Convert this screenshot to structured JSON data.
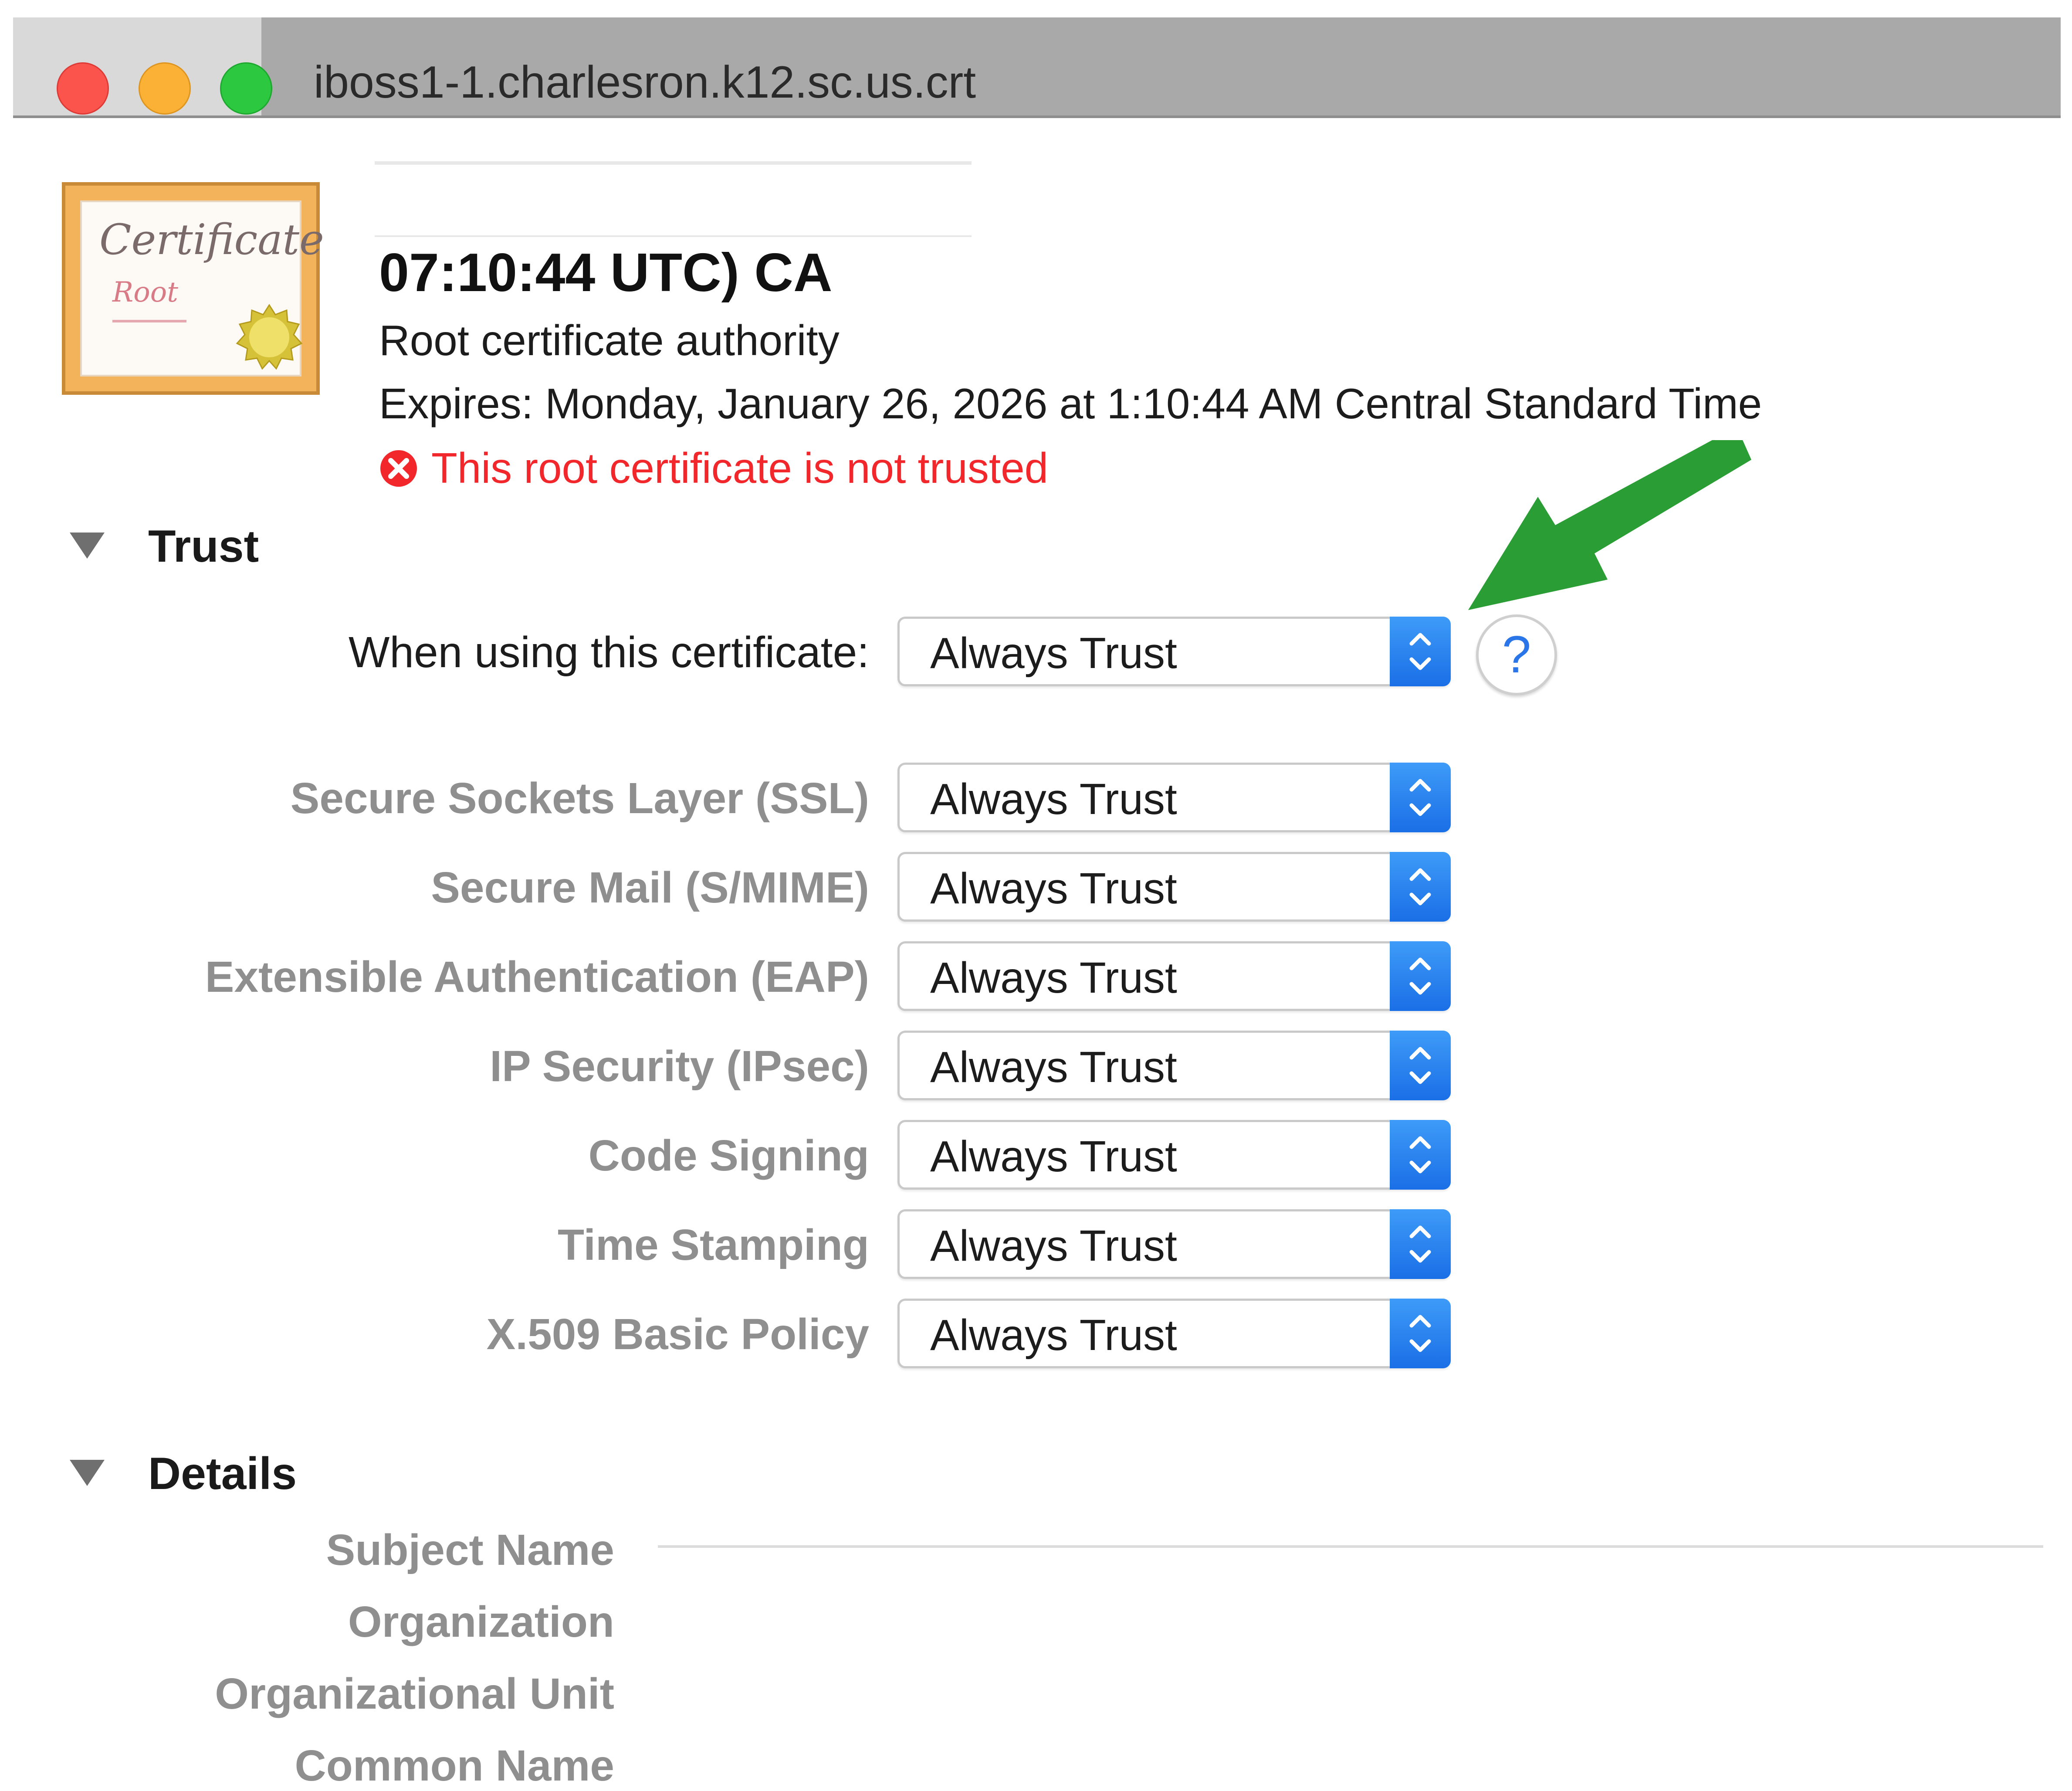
{
  "window": {
    "title": "iboss1-1.charlesron.k12.sc.us.crt"
  },
  "certificate": {
    "name": "07:10:44 UTC) CA",
    "kind": "Root certificate authority",
    "expires": "Expires: Monday, January 26, 2026 at 1:10:44 AM Central Standard Time",
    "status": "This root certificate is not trusted",
    "status_color": "#f2272b",
    "icon_text": "Certificate",
    "icon_subtext": "Root"
  },
  "trust": {
    "title": "Trust",
    "main_label": "When using this certificate:",
    "main_value": "Always Trust",
    "rows": [
      {
        "label": "Secure Sockets Layer (SSL)",
        "value": "Always Trust"
      },
      {
        "label": "Secure Mail (S/MIME)",
        "value": "Always Trust"
      },
      {
        "label": "Extensible Authentication (EAP)",
        "value": "Always Trust"
      },
      {
        "label": "IP Security (IPsec)",
        "value": "Always Trust"
      },
      {
        "label": "Code Signing",
        "value": "Always Trust"
      },
      {
        "label": "Time Stamping",
        "value": "Always Trust"
      },
      {
        "label": "X.509 Basic Policy",
        "value": "Always Trust"
      }
    ],
    "help_symbol": "?"
  },
  "details": {
    "title": "Details",
    "labels": [
      "Subject Name",
      "Organization",
      "Organizational Unit",
      "Common Name"
    ]
  },
  "colors": {
    "accent": "#1a6fe6",
    "arrow": "#2a9d34"
  },
  "icons": {
    "close": "close-icon",
    "minimize": "minimize-icon",
    "zoom": "zoom-icon",
    "error": "error-icon",
    "disclosure": "disclosure-triangle-icon",
    "stepper": "up-down-chevron-icon",
    "help": "help-icon",
    "arrow": "arrow-annotation-icon"
  }
}
